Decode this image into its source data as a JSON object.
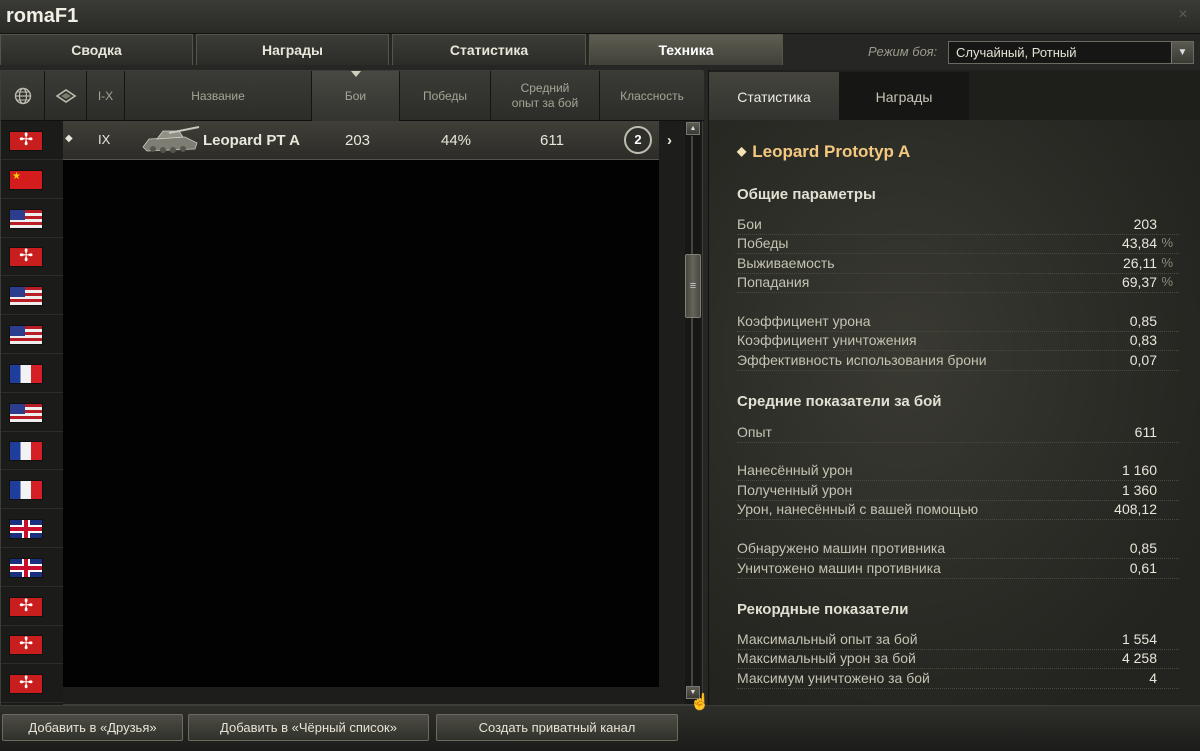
{
  "window": {
    "title": "romaF1",
    "close_label": "×"
  },
  "tabs": [
    {
      "label": "Сводка",
      "active": false
    },
    {
      "label": "Награды",
      "active": false
    },
    {
      "label": "Статистика",
      "active": false
    },
    {
      "label": "Техника",
      "active": true
    }
  ],
  "battle_mode": {
    "label": "Режим боя:",
    "value": "Случайный, Ротный"
  },
  "table": {
    "headers": {
      "nation": "🌐",
      "type": "",
      "tier": "I-X",
      "name": "Название",
      "battles": "Бои",
      "wins": "Победы",
      "avg_xp_line1": "Средний",
      "avg_xp_line2": "опыт за бой",
      "mastery": "Классность"
    },
    "sorted_column": "battles",
    "selected_row": {
      "nation": "germany",
      "class_icon": "td-icon",
      "tier": "IX",
      "name": "Leopard PT A",
      "battles": "203",
      "wins": "44%",
      "avg_xp": "611",
      "mastery": "2"
    },
    "row_flags": [
      "germany",
      "china",
      "usa",
      "germany",
      "usa",
      "usa",
      "france",
      "usa",
      "france",
      "france",
      "uk",
      "uk",
      "germany",
      "germany",
      "germany"
    ]
  },
  "details": {
    "tabs": [
      {
        "label": "Статистика",
        "active": true
      },
      {
        "label": "Награды",
        "active": false
      }
    ],
    "vehicle_name": "Leopard Prototyp A",
    "sections": {
      "general": "Общие параметры",
      "average": "Средние показатели за бой",
      "records": "Рекордные показатели"
    },
    "general": [
      {
        "label": "Бои",
        "value": "203",
        "unit": ""
      },
      {
        "label": "Победы",
        "value": "43,84",
        "unit": "%"
      },
      {
        "label": "Выживаемость",
        "value": "26,11",
        "unit": "%"
      },
      {
        "label": "Попадания",
        "value": "69,37",
        "unit": "%"
      },
      {
        "label": "Коэффициент урона",
        "value": "0,85",
        "unit": ""
      },
      {
        "label": "Коэффициент уничтожения",
        "value": "0,83",
        "unit": ""
      },
      {
        "label": "Эффективность использования брони",
        "value": "0,07",
        "unit": ""
      }
    ],
    "average": [
      {
        "label": "Опыт",
        "value": "611"
      },
      {
        "label": "Нанесённый урон",
        "value": "1 160"
      },
      {
        "label": "Полученный урон",
        "value": "1 360"
      },
      {
        "label": "Урон, нанесённый с вашей помощью",
        "value": "408,12"
      },
      {
        "label": "Обнаружено машин противника",
        "value": "0,85"
      },
      {
        "label": "Уничтожено машин противника",
        "value": "0,61"
      }
    ],
    "records": [
      {
        "label": "Максимальный опыт за бой",
        "value": "1 554"
      },
      {
        "label": "Максимальный урон за бой",
        "value": "4 258"
      },
      {
        "label": "Максимум уничтожено за бой",
        "value": "4"
      }
    ]
  },
  "buttons": {
    "add_friend": "Добавить в «Друзья»",
    "add_blacklist": "Добавить в «Чёрный список»",
    "private_channel": "Создать приватный канал"
  }
}
